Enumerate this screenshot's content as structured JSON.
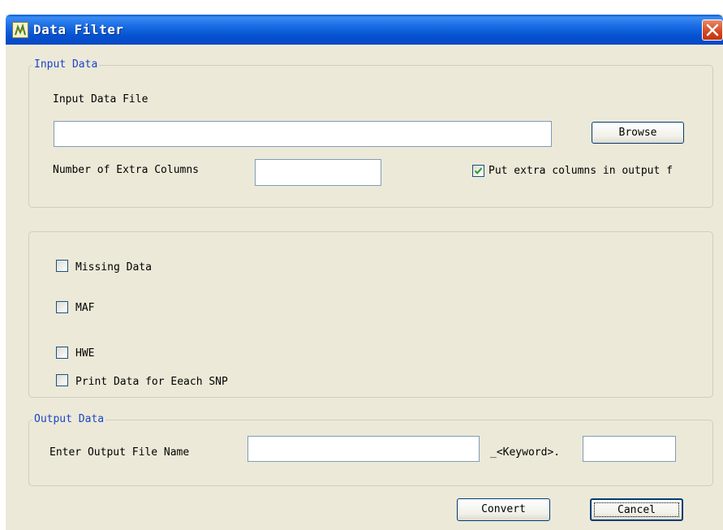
{
  "window": {
    "title": "Data Filter"
  },
  "icons": {
    "app": "app-logo-icon",
    "close": "close-icon",
    "check": "check-icon"
  },
  "colors": {
    "titlebar": "#0a5ed8",
    "group_title": "#1a44c8",
    "dialog_bg": "#ece9d8",
    "close_button": "#d3461f",
    "checkmark": "#21a121"
  },
  "input_group": {
    "legend": "Input Data",
    "file_label": "Input Data File",
    "file_value": "",
    "browse_label": "Browse",
    "extra_cols_label": "Number of Extra Columns",
    "extra_cols_value": "",
    "put_extra_label": "Put extra columns in output f",
    "put_extra_checked": true
  },
  "options": [
    {
      "label": "Missing Data",
      "checked": false
    },
    {
      "label": "MAF",
      "checked": false
    },
    {
      "label": "HWE",
      "checked": false
    },
    {
      "label": "Print Data for Eeach SNP",
      "checked": false
    }
  ],
  "output_group": {
    "legend": "Output Data",
    "filename_label": "Enter Output File Name",
    "filename_value": "",
    "keyword_label": "_<Keyword>.",
    "extension_value": ""
  },
  "buttons": {
    "convert": "Convert",
    "cancel": "Cancel"
  }
}
